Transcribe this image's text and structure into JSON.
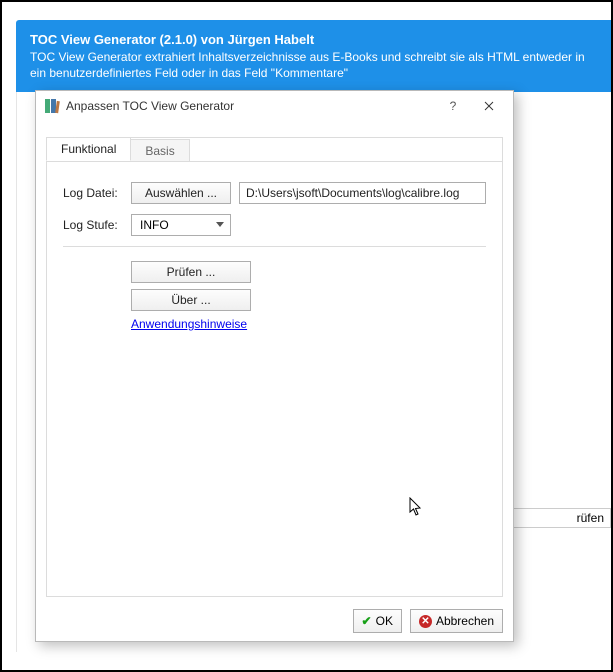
{
  "banner": {
    "title": "TOC View Generator (2.1.0) von Jürgen Habelt",
    "desc": "TOC View Generator extrahiert Inhaltsverzeichnisse aus E-Books und schreibt sie als HTML entweder in ein benutzerdefiniertes Feld oder in das Feld \"Kommentare\""
  },
  "dialog": {
    "title": "Anpassen TOC View Generator",
    "tabs": {
      "funktional": "Funktional",
      "basis": "Basis"
    },
    "labels": {
      "logdatei": "Log Datei:",
      "logstufe": "Log Stufe:"
    },
    "select_btn": "Auswählen ...",
    "log_path": "D:\\Users\\jsoft\\Documents\\log\\calibre.log",
    "log_level": "INFO",
    "pruefen": "Prüfen ...",
    "ueber": "Über ...",
    "hints": "Anwendungshinweise",
    "ok": "OK",
    "cancel": "Abbrechen"
  },
  "background": {
    "row_button": "rüfen"
  }
}
